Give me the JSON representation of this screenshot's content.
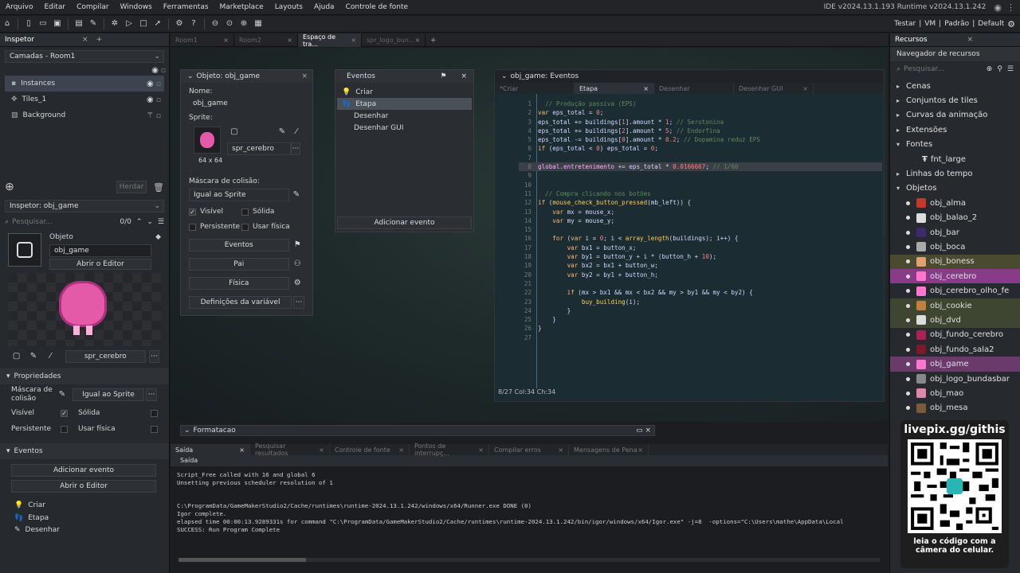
{
  "menu": [
    "Arquivo",
    "Editar",
    "Compilar",
    "Windows",
    "Ferramentas",
    "Marketplace",
    "Layouts",
    "Ajuda",
    "Controle de fonte"
  ],
  "version": "IDE v2024.13.1.193  Runtime v2024.13.1.242",
  "toolbar_right": [
    "Testar",
    "VM",
    "Padrão",
    "Default"
  ],
  "left": {
    "inspector_tab": "Inspetor",
    "layers_title": "Camadas - Room1",
    "layers": [
      "Instances",
      "Tiles_1",
      "Background"
    ],
    "herdar": "Herdar",
    "inspector_obj": "Inspetor: obj_game",
    "search_ph": "Pesquisar...",
    "count": "0/0",
    "object_label": "Objeto",
    "object_name": "obj_game",
    "open_editor": "Abrir o Editor",
    "sprite_name": "spr_cerebro",
    "props_title": "Propriedades",
    "mask_label": "Máscara de colisão",
    "mask_value": "Igual ao Sprite",
    "visible": "Visível",
    "solid": "Sólida",
    "persistent": "Persistente",
    "physics": "Usar física",
    "events_title": "Eventos",
    "add_event": "Adicionar evento",
    "open_editor2": "Abrir o Editor",
    "events": [
      "Criar",
      "Etapa",
      "Desenhar"
    ]
  },
  "tabs": [
    {
      "label": "Room1",
      "active": false
    },
    {
      "label": "Room2",
      "active": false
    },
    {
      "label": "Espaço de tra...",
      "active": true
    },
    {
      "label": "spr_logo_bun...",
      "active": false
    }
  ],
  "objwin": {
    "title": "Objeto: obj_game",
    "name_label": "Nome:",
    "name": "obj_game",
    "sprite_label": "Sprite:",
    "sprite": "spr_cerebro",
    "size": "64 x 64",
    "mask_label": "Máscara de colisão:",
    "mask": "Igual ao Sprite",
    "visible": "Visível",
    "solid": "Sólida",
    "persistent": "Persistente",
    "physics": "Usar física",
    "btn_events": "Eventos",
    "btn_parent": "Pai",
    "btn_physics": "Física",
    "btn_vars": "Definições da variável"
  },
  "eventswin": {
    "title": "Eventos",
    "items": [
      "Criar",
      "Etapa",
      "Desenhar",
      "Desenhar GUI"
    ],
    "add": "Adicionar evento"
  },
  "codewin": {
    "title": "obj_game: Eventos",
    "tabs": [
      "*Criar",
      "Etapa",
      "Desenhar",
      "Desenhar GUI"
    ],
    "status": "8/27 Col:34 Ch:34",
    "lines": [
      "  // Produção passiva (EPS)",
      "var eps_total = 0;",
      "eps_total += buildings[1].amount * 1; // Serotonina",
      "eps_total += buildings[2].amount * 5; // Endorfina",
      "eps_total -= buildings[0].amount * 0.2; // Dopamina reduz EPS",
      "if (eps_total < 0) eps_total = 0;",
      "",
      "global.entretenimento += eps_total * 0.0166667; // 1/60",
      "",
      "",
      "  // Compra clicando nos botões",
      "if (mouse_check_button_pressed(mb_left)) {",
      "    var mx = mouse_x;",
      "    var my = mouse_y;",
      "",
      "    for (var i = 0; i < array_length(buildings); i++) {",
      "        var bx1 = button_x;",
      "        var by1 = button_y + i * (button_h + 10);",
      "        var bx2 = bx1 + button_w;",
      "        var by2 = by1 + button_h;",
      "",
      "        if (mx > bx1 && mx < bx2 && my > by1 && my < by2) {",
      "            buy_building(i);",
      "        }",
      "    }",
      "}",
      ""
    ]
  },
  "formatacao": "Formatacao",
  "bottom_tabs": [
    "Saída",
    "Pesquisar resultados",
    "Controle de fonte",
    "Pontos de interrupç...",
    "Compilar erros",
    "Mensagens de Pena"
  ],
  "output_title": "Saída",
  "output": [
    "Script_Free called with 16 and global 6",
    "Unsetting previous scheduler resolution of 1",
    "",
    "",
    "C:\\ProgramData/GameMakerStudio2/Cache/runtimes\\runtime-2024.13.1.242/windows/x64/Runner.exe DONE (0)",
    "Igor complete.",
    "elapsed time 00:00:13.9289331s for command \"C:\\ProgramData/GameMakerStudio2/Cache/runtimes\\runtime-2024.13.1.242/bin/igor/windows/x64/Igor.exe\" -j=8  -options=\"C:\\Users\\mathe\\AppData\\Local",
    "SUCCESS: Run Program Complete"
  ],
  "right": {
    "tab": "Recursos",
    "nav": "Navegador de recursos",
    "search_ph": "Pesquisar...",
    "items": [
      {
        "label": "Cenas",
        "kind": "folder"
      },
      {
        "label": "Conjuntos de tiles",
        "kind": "folder"
      },
      {
        "label": "Curvas da animação",
        "kind": "folder"
      },
      {
        "label": "Extensões",
        "kind": "folder"
      },
      {
        "label": "Fontes",
        "kind": "open"
      },
      {
        "label": "fnt_large",
        "kind": "font"
      },
      {
        "label": "Linhas do tempo",
        "kind": "folder"
      },
      {
        "label": "Objetos",
        "kind": "open"
      },
      {
        "label": "obj_alma",
        "kind": "obj",
        "color": "#c0392b"
      },
      {
        "label": "obj_balao_2",
        "kind": "obj",
        "color": "#dddddd"
      },
      {
        "label": "obj_bar",
        "kind": "obj",
        "color": "#3b2a6e"
      },
      {
        "label": "obj_boca",
        "kind": "obj",
        "color": "#aaaaaa"
      },
      {
        "label": "obj_boness",
        "kind": "obj",
        "color": "#e0a070",
        "hl": "#4a4a30"
      },
      {
        "label": "obj_cerebro",
        "kind": "obj",
        "color": "#ff77cc",
        "hl": "#8a3a88"
      },
      {
        "label": "obj_cerebro_olho_fe",
        "kind": "obj",
        "color": "#ff77cc"
      },
      {
        "label": "obj_cookie",
        "kind": "obj",
        "color": "#c08040",
        "hl": "#3e4530"
      },
      {
        "label": "obj_dvd",
        "kind": "obj",
        "color": "#dddddd",
        "hl": "#3e4530"
      },
      {
        "label": "obj_fundo_cerebro",
        "kind": "obj",
        "color": "#aa2255"
      },
      {
        "label": "obj_fundo_sala2",
        "kind": "obj",
        "color": "#7a1a2a"
      },
      {
        "label": "obj_game",
        "kind": "obj",
        "color": "#ff77cc",
        "hl": "#6a3a6a"
      },
      {
        "label": "obj_logo_bundasbar",
        "kind": "obj",
        "color": "#888888"
      },
      {
        "label": "obj_mao",
        "kind": "obj",
        "color": "#dd88aa"
      },
      {
        "label": "obj_mesa",
        "kind": "obj",
        "color": "#7a5a3a"
      }
    ]
  },
  "qr": {
    "url": "livepix.gg/githis",
    "caption": "leia o código com a câmera do celular."
  }
}
